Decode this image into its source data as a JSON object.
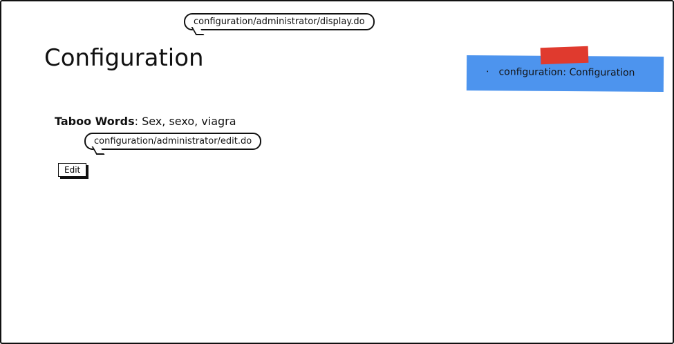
{
  "annotations": {
    "display_url": "configuration/administrator/display.do",
    "edit_url": "configuration/administrator/edit.do"
  },
  "page": {
    "title": "Configuration"
  },
  "content": {
    "taboo_label": "Taboo Words",
    "taboo_sep": ": ",
    "taboo_value": "Sex, sexo, viagra",
    "edit_label": "Edit"
  },
  "sticky_note": {
    "item": "configuration: Configuration",
    "color": "#4d94ee",
    "tape_color": "#e03a2e"
  }
}
